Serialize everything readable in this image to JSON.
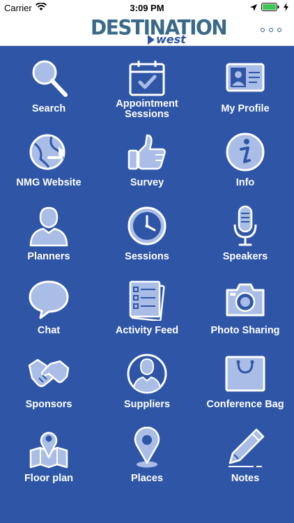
{
  "status_bar": {
    "carrier": "Carrier",
    "time": "3:09 PM"
  },
  "header": {
    "logo_text": "DESTINATION",
    "logo_subtext": "west"
  },
  "menu": [
    {
      "label": "Search",
      "icon": "search-icon"
    },
    {
      "label": "Appointment Sessions",
      "icon": "calendar-check-icon"
    },
    {
      "label": "My Profile",
      "icon": "profile-card-icon"
    },
    {
      "label": "NMG Website",
      "icon": "globe-icon"
    },
    {
      "label": "Survey",
      "icon": "thumbs-up-icon"
    },
    {
      "label": "Info",
      "icon": "info-icon"
    },
    {
      "label": "Planners",
      "icon": "person-icon"
    },
    {
      "label": "Sessions",
      "icon": "clock-icon"
    },
    {
      "label": "Speakers",
      "icon": "microphone-icon"
    },
    {
      "label": "Chat",
      "icon": "speech-bubble-icon"
    },
    {
      "label": "Activity Feed",
      "icon": "checklist-icon"
    },
    {
      "label": "Photo Sharing",
      "icon": "camera-icon"
    },
    {
      "label": "Sponsors",
      "icon": "handshake-icon"
    },
    {
      "label": "Suppliers",
      "icon": "person-circle-icon"
    },
    {
      "label": "Conference Bag",
      "icon": "bag-icon"
    },
    {
      "label": "Floor plan",
      "icon": "map-icon"
    },
    {
      "label": "Places",
      "icon": "map-pin-icon"
    },
    {
      "label": "Notes",
      "icon": "pen-icon"
    }
  ],
  "colors": {
    "background": "#2f56a6",
    "icon_fill": "#a9bde6",
    "icon_stroke": "#ffffff"
  }
}
